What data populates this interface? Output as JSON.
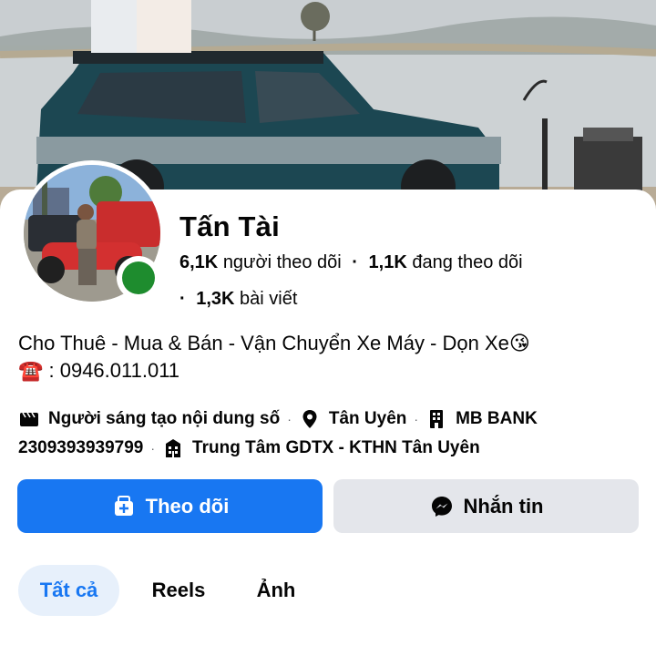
{
  "profile": {
    "name": "Tấn Tài",
    "followers_count": "6,1K",
    "followers_label": "người theo dõi",
    "following_count": "1,1K",
    "following_label": "đang theo dõi",
    "posts_count": "1,3K",
    "posts_label": "bài viết",
    "online": true,
    "online_color": "#1e8c2e"
  },
  "bio": {
    "line1": "Cho Thuê - Mua & Bán - Vận Chuyển Xe Máy - Dọn Xe😘",
    "line2": "☎️ : 0946.011.011"
  },
  "info": {
    "category": "Người sáng tạo nội dung số",
    "location": "Tân Uyên",
    "bank": "MB BANK",
    "account": "2309393939799",
    "education": "Trung Tâm GDTX - KTHN Tân Uyên"
  },
  "actions": {
    "follow_label": "Theo dõi",
    "message_label": "Nhắn tin"
  },
  "tabs": [
    {
      "label": "Tất cả",
      "active": true
    },
    {
      "label": "Reels",
      "active": false
    },
    {
      "label": "Ảnh",
      "active": false
    }
  ],
  "colors": {
    "accent": "#1877f2",
    "secondary_button": "#e4e6eb",
    "active_tab_bg": "#e7f0fb"
  },
  "icons": {
    "category": "clapperboard-icon",
    "location": "map-pin-icon",
    "bank": "building-icon",
    "education": "school-icon",
    "follow": "follow-icon",
    "message": "messenger-icon"
  }
}
